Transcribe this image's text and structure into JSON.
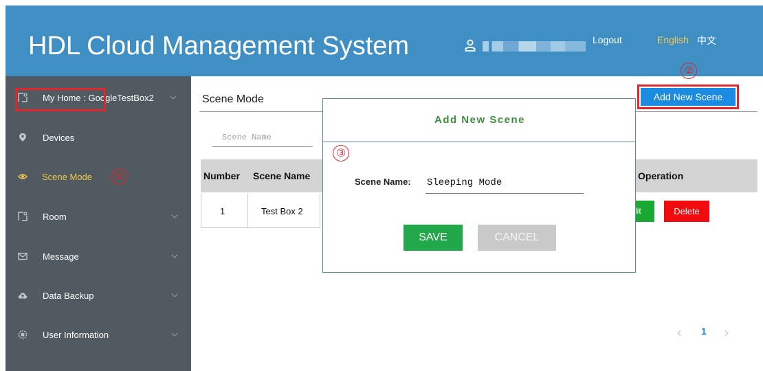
{
  "header": {
    "title": "HDL Cloud Management System",
    "user_icon": "user-icon",
    "logout_label": "Logout",
    "lang_english": "English",
    "lang_chinese": "中文"
  },
  "sidebar": {
    "items": [
      {
        "label": "My Home : GoogleTestBox2",
        "icon": "home-icon",
        "has_chevron": true
      },
      {
        "label": "Devices",
        "icon": "location-pin-icon",
        "has_chevron": false
      },
      {
        "label": "Scene Mode",
        "icon": "eye-icon",
        "has_chevron": false,
        "active": true
      },
      {
        "label": "Room",
        "icon": "room-icon",
        "has_chevron": true
      },
      {
        "label": "Message",
        "icon": "envelope-icon",
        "has_chevron": true
      },
      {
        "label": "Data Backup",
        "icon": "cloud-upload-icon",
        "has_chevron": true
      },
      {
        "label": "User Information",
        "icon": "user-settings-icon",
        "has_chevron": true
      }
    ]
  },
  "annotations": {
    "step1": "①",
    "step2": "②",
    "step3": "③"
  },
  "main": {
    "title": "Scene Mode",
    "add_button": "Add New Scene",
    "search_placeholder": "Scene Name",
    "table": {
      "headers": {
        "number": "Number",
        "scene_name": "Scene Name",
        "operation": "Operation"
      },
      "rows": [
        {
          "number": "1",
          "scene_name": "Test Box 2",
          "edit": "Edit",
          "edit_visible": "dit",
          "delete": "Delete"
        }
      ]
    },
    "pagination": {
      "prev": "‹",
      "page": "1",
      "next": "›"
    }
  },
  "modal": {
    "title": "Add New Scene",
    "field_label": "Scene Name:",
    "field_value": "Sleeping Mode",
    "save_label": "SAVE",
    "cancel_label": "CANCEL"
  },
  "colors": {
    "header_bg": "#3f8fc4",
    "sidebar_bg": "#515a60",
    "primary_button": "#1a8be0",
    "save_green": "#22a84a",
    "edit_green": "#19a832",
    "delete_red": "#f00c0c",
    "annotation_red": "#e0262b",
    "modal_title_green": "#3c8f3c",
    "active_language": "#f3c94d"
  }
}
